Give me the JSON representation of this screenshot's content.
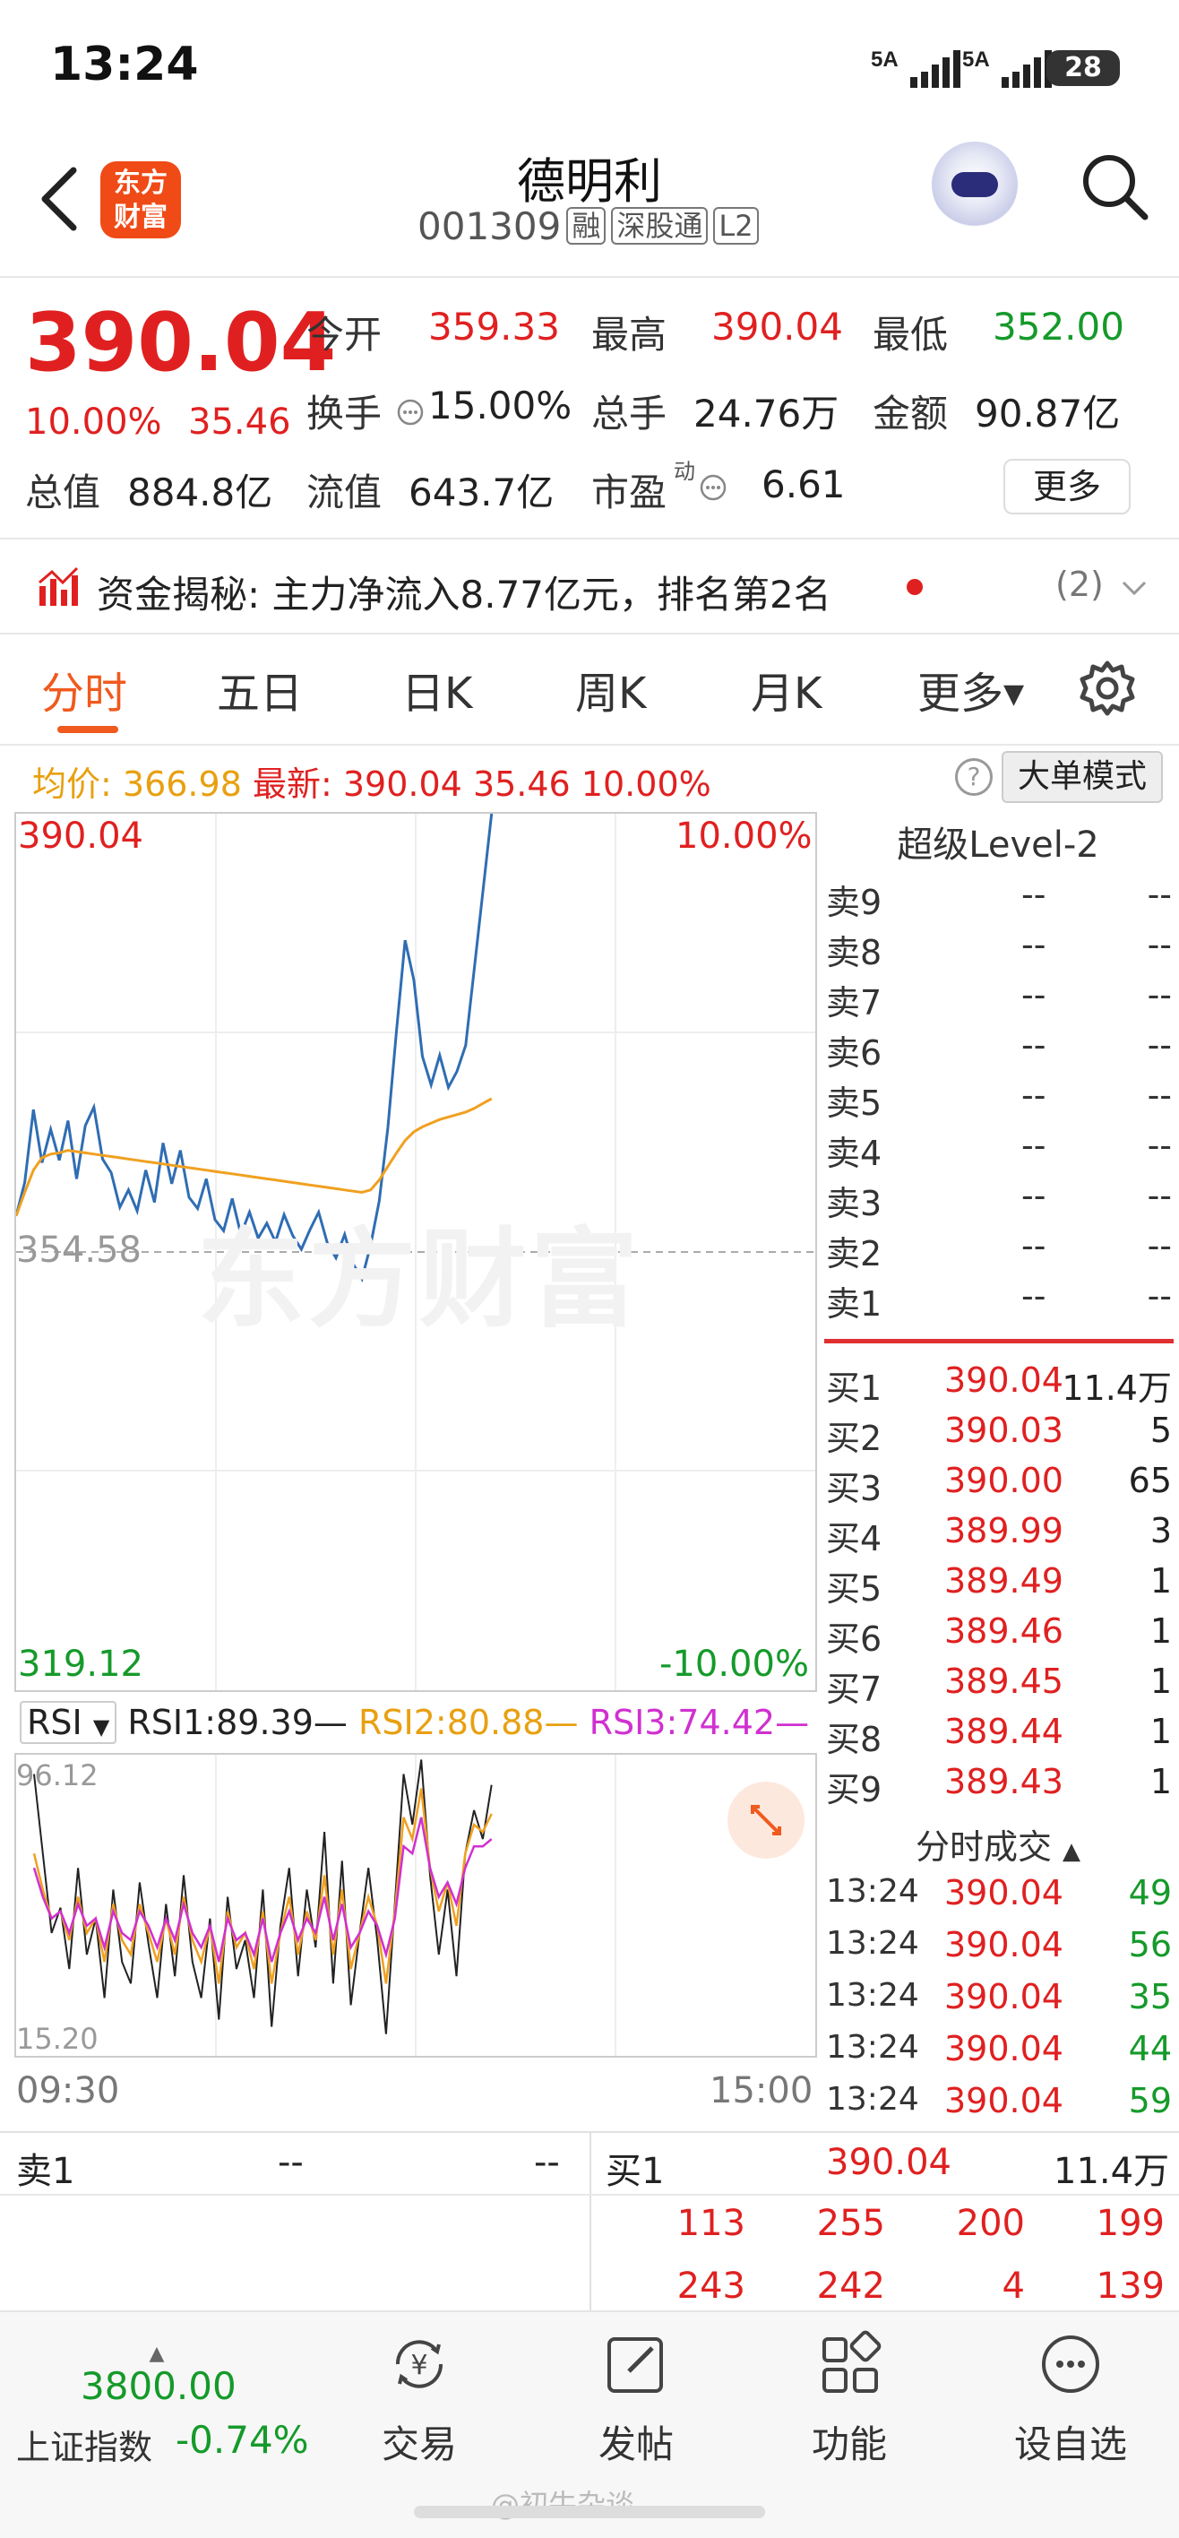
{
  "status_bar": {
    "time": "13:24",
    "signal1": "5A",
    "signal2": "5A",
    "battery": "28"
  },
  "header": {
    "name": "德明利",
    "code": "001309",
    "tags": [
      "融",
      "深股通",
      "L2"
    ],
    "logo_line1": "东方",
    "logo_line2": "财富"
  },
  "quote": {
    "price": "390.04",
    "pct": "10.00%",
    "change": "35.46",
    "rows": [
      [
        {
          "label": "今开",
          "value": "359.33",
          "color": "red"
        },
        {
          "label": "最高",
          "value": "390.04",
          "color": "red"
        },
        {
          "label": "最低",
          "value": "352.00",
          "color": "green"
        }
      ],
      [
        {
          "label": "换手",
          "value": "15.00%",
          "color": "black"
        },
        {
          "label": "总手",
          "value": "24.76万",
          "color": "black"
        },
        {
          "label": "金额",
          "value": "90.87亿",
          "color": "black"
        }
      ],
      [
        {
          "label": "总值",
          "value": "884.8亿",
          "color": "black"
        },
        {
          "label": "流值",
          "value": "643.7亿",
          "color": "black"
        },
        {
          "label": "市盈",
          "value": "6.61",
          "color": "black"
        }
      ]
    ],
    "pe_superscript": "动",
    "more_label": "更多"
  },
  "news": {
    "label": "资金揭秘:",
    "text": "主力净流入8.77亿元，排名第2名",
    "count": "(2)"
  },
  "tabs": [
    "分时",
    "五日",
    "日K",
    "周K",
    "月K",
    "更多"
  ],
  "info": {
    "avg_label": "均价:",
    "avg": "366.98",
    "latest_label": "最新:",
    "latest": "390.04",
    "chg": "35.46",
    "pct": "10.00%",
    "bigorder_btn": "大单模式"
  },
  "chart_labels": {
    "top_price": "390.04",
    "top_pct": "10.00%",
    "mid_price": "354.58",
    "bottom_price": "319.12",
    "bottom_pct": "-10.00%",
    "watermark": "东方财富"
  },
  "chart_data": {
    "type": "line",
    "ylim": [
      319.12,
      390.04
    ],
    "prev_close": 354.58,
    "x_range": [
      "09:30",
      "15:00"
    ],
    "series": [
      {
        "name": "",
        "color": "#2f6db3",
        "values": [
          357.5,
          360.2,
          366.1,
          361.8,
          364.5,
          362.0,
          365.2,
          360.5,
          364.8,
          366.3,
          362.1,
          361.0,
          358.2,
          359.6,
          357.9,
          361.2,
          358.6,
          363.4,
          360.1,
          362.8,
          359.0,
          358.1,
          360.5,
          357.2,
          356.3,
          358.9,
          356.0,
          357.8,
          355.7,
          356.9,
          355.4,
          357.6,
          355.9,
          354.8,
          356.4,
          357.8,
          355.3,
          354.1,
          356.0,
          353.6,
          352.4,
          355.1,
          358.7,
          364.6,
          372.5,
          379.8,
          376.6,
          370.4,
          368.1,
          370.5,
          367.9,
          369.2,
          371.3,
          377.5,
          383.8,
          390.04
        ]
      },
      {
        "name": "",
        "color": "#f0a020",
        "values": [
          357.5,
          359.4,
          361.2,
          362.2,
          362.5,
          362.6,
          362.8,
          362.7,
          362.6,
          362.5,
          362.4,
          362.3,
          362.2,
          362.1,
          362.0,
          361.9,
          361.8,
          361.7,
          361.6,
          361.5,
          361.4,
          361.3,
          361.2,
          361.1,
          361.0,
          360.9,
          360.8,
          360.7,
          360.6,
          360.5,
          360.4,
          360.3,
          360.2,
          360.1,
          360.0,
          359.9,
          359.8,
          359.7,
          359.6,
          359.5,
          359.4,
          359.6,
          360.4,
          361.5,
          362.6,
          363.6,
          364.3,
          364.7,
          365.0,
          365.3,
          365.5,
          365.7,
          365.9,
          366.2,
          366.6,
          366.98
        ]
      }
    ]
  },
  "rsi": {
    "selector": "RSI",
    "rsi1": "RSI1:89.39",
    "rsi2": "RSI2:80.88",
    "rsi3": "RSI3:74.42",
    "ymax": "96.12",
    "ymin": "15.20",
    "x_start": "09:30",
    "x_end": "15:00",
    "values": {
      "rsi1": [
        92,
        70,
        48,
        55,
        38,
        66,
        42,
        52,
        30,
        60,
        40,
        34,
        62,
        45,
        30,
        56,
        36,
        64,
        40,
        30,
        52,
        24,
        58,
        38,
        46,
        30,
        60,
        22,
        50,
        66,
        36,
        60,
        44,
        76,
        34,
        68,
        28,
        48,
        66,
        46,
        20,
        56,
        92,
        78,
        96,
        64,
        42,
        60,
        36,
        70,
        82,
        74,
        89
      ],
      "rsi2": [
        70,
        60,
        52,
        54,
        46,
        58,
        48,
        52,
        40,
        56,
        46,
        42,
        56,
        48,
        40,
        52,
        42,
        58,
        46,
        40,
        50,
        34,
        54,
        44,
        48,
        38,
        54,
        34,
        48,
        58,
        42,
        54,
        46,
        64,
        42,
        60,
        38,
        48,
        58,
        50,
        34,
        54,
        80,
        74,
        88,
        66,
        54,
        62,
        50,
        70,
        78,
        76,
        81
      ],
      "rsi3": [
        66,
        58,
        52,
        54,
        48,
        56,
        50,
        52,
        44,
        54,
        48,
        46,
        54,
        50,
        44,
        52,
        46,
        56,
        48,
        44,
        50,
        40,
        52,
        46,
        48,
        42,
        52,
        40,
        48,
        54,
        46,
        52,
        48,
        58,
        46,
        56,
        44,
        48,
        54,
        50,
        42,
        52,
        72,
        70,
        80,
        66,
        58,
        62,
        56,
        66,
        72,
        72,
        74
      ]
    }
  },
  "level2": {
    "title": "超级Level-2",
    "asks": [
      {
        "label": "卖9",
        "price": "--",
        "vol": "--"
      },
      {
        "label": "卖8",
        "price": "--",
        "vol": "--"
      },
      {
        "label": "卖7",
        "price": "--",
        "vol": "--"
      },
      {
        "label": "卖6",
        "price": "--",
        "vol": "--"
      },
      {
        "label": "卖5",
        "price": "--",
        "vol": "--"
      },
      {
        "label": "卖4",
        "price": "--",
        "vol": "--"
      },
      {
        "label": "卖3",
        "price": "--",
        "vol": "--"
      },
      {
        "label": "卖2",
        "price": "--",
        "vol": "--"
      },
      {
        "label": "卖1",
        "price": "--",
        "vol": "--"
      }
    ],
    "bids": [
      {
        "label": "买1",
        "price": "390.04",
        "vol": "11.4万"
      },
      {
        "label": "买2",
        "price": "390.03",
        "vol": "5"
      },
      {
        "label": "买3",
        "price": "390.00",
        "vol": "65"
      },
      {
        "label": "买4",
        "price": "389.99",
        "vol": "3"
      },
      {
        "label": "买5",
        "price": "389.49",
        "vol": "1"
      },
      {
        "label": "买6",
        "price": "389.46",
        "vol": "1"
      },
      {
        "label": "买7",
        "price": "389.45",
        "vol": "1"
      },
      {
        "label": "买8",
        "price": "389.44",
        "vol": "1"
      },
      {
        "label": "买9",
        "price": "389.43",
        "vol": "1"
      }
    ]
  },
  "trades": {
    "title": "分时成交",
    "rows": [
      {
        "time": "13:24",
        "price": "390.04",
        "vol": "49"
      },
      {
        "time": "13:24",
        "price": "390.04",
        "vol": "56"
      },
      {
        "time": "13:24",
        "price": "390.04",
        "vol": "35"
      },
      {
        "time": "13:24",
        "price": "390.04",
        "vol": "44"
      },
      {
        "time": "13:24",
        "price": "390.04",
        "vol": "59"
      }
    ]
  },
  "board": {
    "sell_label": "卖1",
    "sell_price": "--",
    "sell_vol": "--",
    "buy_label": "买1",
    "buy_price": "390.04",
    "buy_vol": "11.4万",
    "queue_row1": [
      "113",
      "255",
      "200",
      "199"
    ],
    "queue_row2": [
      "243",
      "242",
      "4",
      "139"
    ]
  },
  "nav": {
    "index_value": "3800.00",
    "index_name": "上证指数",
    "index_pct": "-0.74%",
    "items": [
      {
        "label": "交易",
        "icon": "yen-cycle-icon"
      },
      {
        "label": "发帖",
        "icon": "edit-icon"
      },
      {
        "label": "功能",
        "icon": "grid-icon"
      },
      {
        "label": "设自选",
        "icon": "more-icon"
      }
    ]
  },
  "watermark_bottom": "@初牛杂谈",
  "colors": {
    "up": "#e02020",
    "down": "#159a2a",
    "accent": "#f05a1e",
    "price_line": "#2f6db3",
    "avg_line": "#f0a020"
  }
}
